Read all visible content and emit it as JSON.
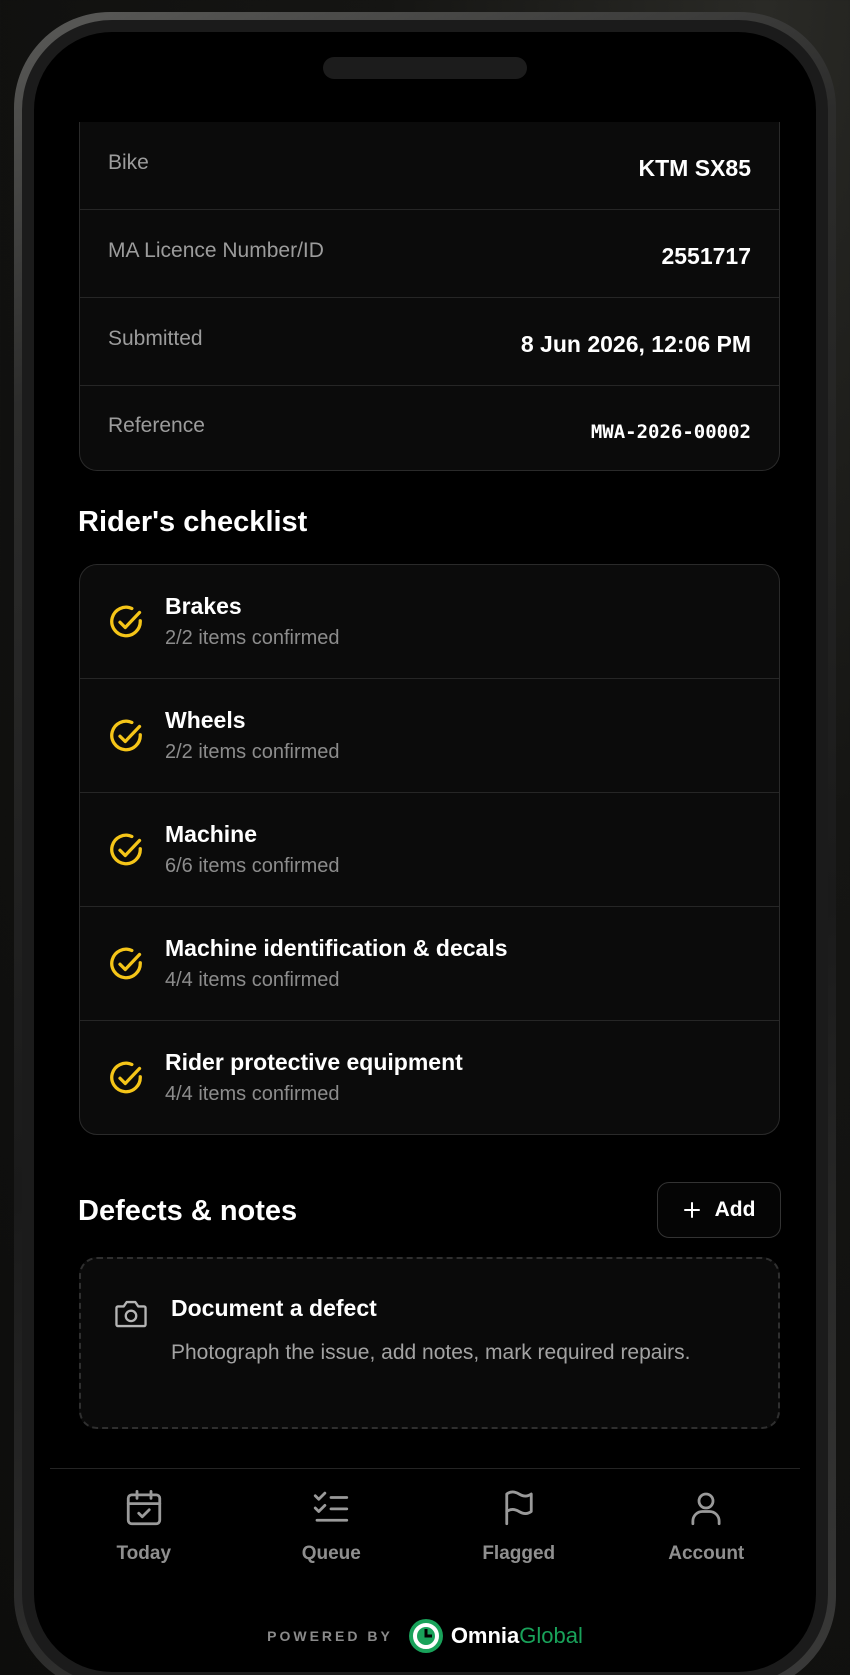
{
  "details": [
    {
      "label": "Bike",
      "value": "KTM SX85"
    },
    {
      "label": "MA Licence Number/ID",
      "value": "2551717"
    },
    {
      "label": "Submitted",
      "value": "8 Jun 2026, 12:06 PM"
    },
    {
      "label": "Reference",
      "value": "MWA-2026-00002"
    }
  ],
  "checklist": {
    "title": "Rider's checklist",
    "items": [
      {
        "title": "Brakes",
        "status": "2/2 items confirmed"
      },
      {
        "title": "Wheels",
        "status": "2/2 items confirmed"
      },
      {
        "title": "Machine",
        "status": "6/6 items confirmed"
      },
      {
        "title": "Machine identification & decals",
        "status": "4/4 items confirmed"
      },
      {
        "title": "Rider protective equipment",
        "status": "4/4 items confirmed"
      }
    ]
  },
  "defects": {
    "title": "Defects & notes",
    "add_label": "Add",
    "card_title": "Document a defect",
    "card_desc": "Photograph the issue, add notes, mark required repairs."
  },
  "nav": [
    {
      "label": "Today",
      "icon": "calendar-check-icon"
    },
    {
      "label": "Queue",
      "icon": "list-checks-icon"
    },
    {
      "label": "Flagged",
      "icon": "flag-icon"
    },
    {
      "label": "Account",
      "icon": "user-icon"
    }
  ],
  "footer": {
    "powered_by": "POWERED BY",
    "brand_part1": "Omnia",
    "brand_part2": "Global"
  },
  "colors": {
    "accent": "#F5C518",
    "brand_green": "#19A25A",
    "background": "#000000"
  }
}
